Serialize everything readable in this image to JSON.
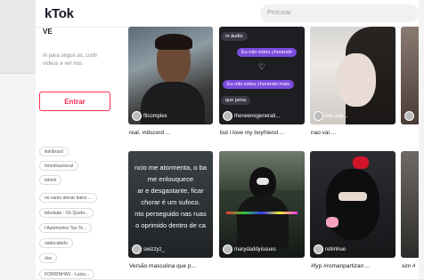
{
  "header": {
    "logo": "kTok",
    "search_placeholder": "Procurar"
  },
  "sidebar": {
    "title": "VE",
    "desc": "ín para seguir as, curtir vídeos e ver rios.",
    "login_label": "Entrar",
    "tags": [
      "itoklbrasil",
      "tomotivacional",
      "toktok",
      "no vamo deixar baixo ...",
      "tebolada - Os Quebr...",
      "l Automotivo Tan To...",
      "nadocabelo",
      "dos",
      "FORRINHAS - Luiza..."
    ]
  },
  "videos": [
    {
      "caption": "real. #discord ...",
      "author": "filcomplex"
    },
    {
      "caption": "but i love my boyfriend ...",
      "author": "thenewregenerati...",
      "chat": {
        "top": "m áudio",
        "out1": "Eu não estou chorando",
        "in1": "Eu não estou chorando mais",
        "out2": "que pena"
      }
    },
    {
      "caption": "nao vai ...",
      "author": "lolo.zap..."
    },
    {
      "caption": "",
      "author": ""
    },
    {
      "caption": "Versão masculina que p...",
      "author": "swizzyz_",
      "overlay": [
        "ncio me atormenta, o ba",
        "me enlouquece",
        "ar e desgastante, ficar",
        "chorar é um sufoco.",
        "nto perseguido nas ruas",
        "o oprimido dentro de ca"
      ]
    },
    {
      "caption": "",
      "author": "marydaddyissues"
    },
    {
      "caption": "#fyp #romanpartizan ...",
      "author": "retiinhue"
    },
    {
      "caption": "sim #",
      "author": ""
    }
  ],
  "colors": {
    "accent": "#fe2c55",
    "chat_out": "#7a4dde"
  }
}
